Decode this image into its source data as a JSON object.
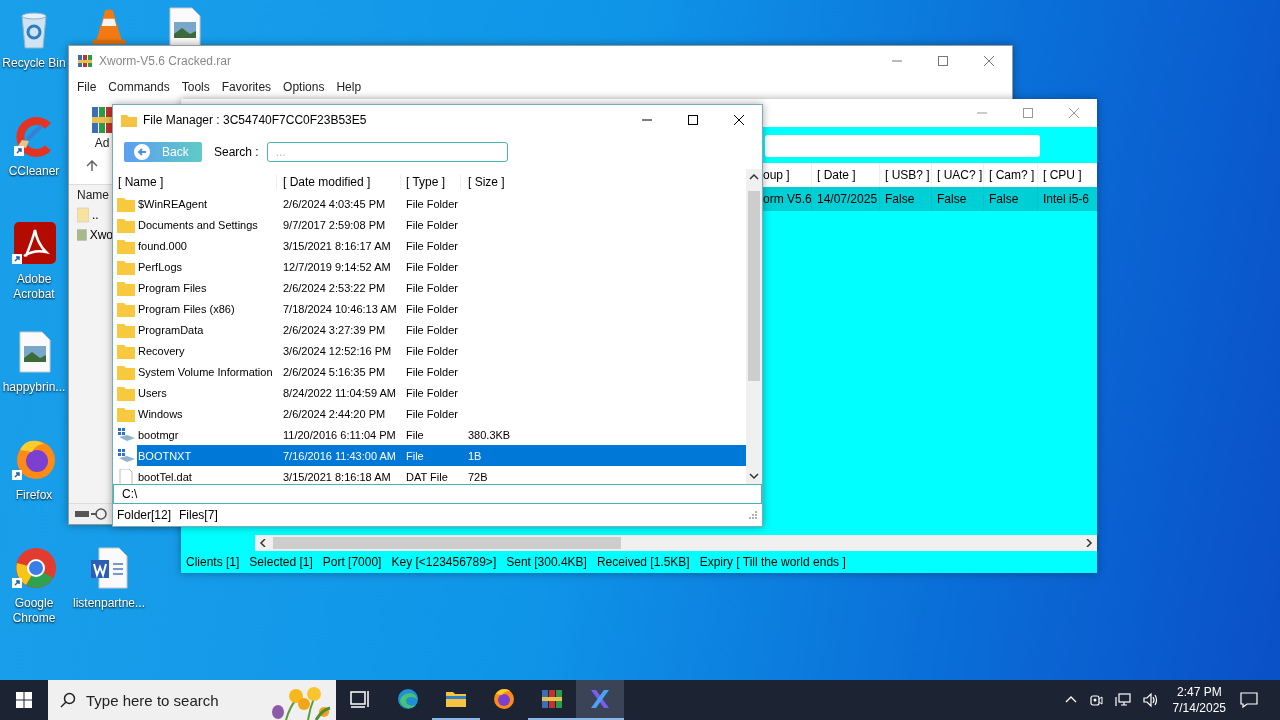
{
  "desktop_icons": [
    {
      "kind": "recycle-bin",
      "label": "Recycle Bin"
    },
    {
      "kind": "traffic-cone"
    },
    {
      "kind": "image-file"
    },
    {
      "kind": "ccleaner",
      "label": "CCleaner"
    },
    {
      "kind": "pdf-reader",
      "label": "Adobe Acrobat"
    },
    {
      "kind": "image-file",
      "label": "happybrin..."
    },
    {
      "kind": "firefox",
      "label": "Firefox"
    },
    {
      "kind": "chrome",
      "label": "Google Chrome"
    },
    {
      "kind": "word-doc",
      "label": "listenpartne..."
    }
  ],
  "winrar": {
    "title": "Xworm-V5.6 Cracked.rar",
    "menu": [
      "File",
      "Commands",
      "Tools",
      "Favorites",
      "Options",
      "Help"
    ],
    "add_label": "Ad",
    "list_header": "Name",
    "items": [
      {
        "name": "..",
        "kind": "parent"
      },
      {
        "name": "Xwo",
        "kind": "archive"
      }
    ]
  },
  "xworm": {
    "columns": [
      "oup ]",
      "[ Date ]",
      "[ USB? ]",
      "[ UAC? ]",
      "[ Cam? ]",
      "[ CPU ]"
    ],
    "rows": [
      {
        "cells": [
          "orm V5.6",
          "14/07/2025",
          "False",
          "False",
          "False",
          "Intel i5-6"
        ],
        "selected": true
      }
    ],
    "status": [
      "Clients [1]",
      "Selected [1]",
      "Port [7000]",
      "Key [<123456789>]",
      "Sent [300.4KB]",
      "Received [1.5KB]",
      "Expiry [ Till the world ends ]"
    ]
  },
  "file_manager": {
    "title": "File Manager : 3C54740F7CC0F23B53E5",
    "back": "Back",
    "search_label": "Search :",
    "search_placeholder": "...",
    "columns": [
      "[ Name ]",
      "[ Date modified ]",
      "[ Type ]",
      "[ Size ]"
    ],
    "rows": [
      {
        "kind": "folder",
        "name": "$WinREAgent",
        "date": "2/6/2024 4:03:45 PM",
        "type": "File Folder",
        "selected": false
      },
      {
        "kind": "folder",
        "name": "Documents and Settings",
        "date": "9/7/2017 2:59:08 PM",
        "type": "File Folder",
        "selected": false
      },
      {
        "kind": "folder",
        "name": "found.000",
        "date": "3/15/2021 8:16:17 AM",
        "type": "File Folder",
        "selected": false
      },
      {
        "kind": "folder",
        "name": "PerfLogs",
        "date": "12/7/2019 9:14:52 AM",
        "type": "File Folder",
        "selected": false
      },
      {
        "kind": "folder",
        "name": "Program Files",
        "date": "2/6/2024 2:53:22 PM",
        "type": "File Folder",
        "selected": false
      },
      {
        "kind": "folder",
        "name": "Program Files (x86)",
        "date": "7/18/2024 10:46:13 AM",
        "type": "File Folder",
        "selected": false
      },
      {
        "kind": "folder",
        "name": "ProgramData",
        "date": "2/6/2024 3:27:39 PM",
        "type": "File Folder",
        "selected": false
      },
      {
        "kind": "folder",
        "name": "Recovery",
        "date": "3/6/2024 12:52:16 PM",
        "type": "File Folder",
        "selected": false
      },
      {
        "kind": "folder",
        "name": "System Volume Information",
        "date": "2/6/2024 5:16:35 PM",
        "type": "File Folder",
        "selected": false
      },
      {
        "kind": "folder",
        "name": "Users",
        "date": "8/24/2022 11:04:59 AM",
        "type": "File Folder",
        "selected": false
      },
      {
        "kind": "folder",
        "name": "Windows",
        "date": "2/6/2024 2:44:20 PM",
        "type": "File Folder",
        "selected": false
      },
      {
        "kind": "system",
        "name": "bootmgr",
        "date": "11/20/2016 6:11:04 PM",
        "type": "File",
        "size": "380.3KB",
        "selected": false
      },
      {
        "kind": "system",
        "name": "BOOTNXT",
        "date": "7/16/2016 11:43:00 AM",
        "type": "File",
        "size": "1B",
        "selected": true
      },
      {
        "kind": "file",
        "name": "bootTel.dat",
        "date": "3/15/2021 8:16:18 AM",
        "type": "DAT File",
        "size": "72B",
        "selected": false
      }
    ],
    "path": "C:\\",
    "status": [
      "Folder[12]",
      "Files[7]"
    ]
  },
  "taskbar": {
    "search_placeholder": "Type here to search",
    "apps": [
      {
        "kind": "task-view",
        "running": false,
        "selected": false
      },
      {
        "kind": "edge",
        "running": false,
        "selected": false
      },
      {
        "kind": "explorer",
        "running": true,
        "selected": false
      },
      {
        "kind": "firefox",
        "running": false,
        "selected": false
      },
      {
        "kind": "winrar",
        "running": true,
        "selected": false
      },
      {
        "kind": "xworm",
        "running": true,
        "selected": true
      }
    ],
    "time": "2:47 PM",
    "date": "7/14/2025"
  }
}
